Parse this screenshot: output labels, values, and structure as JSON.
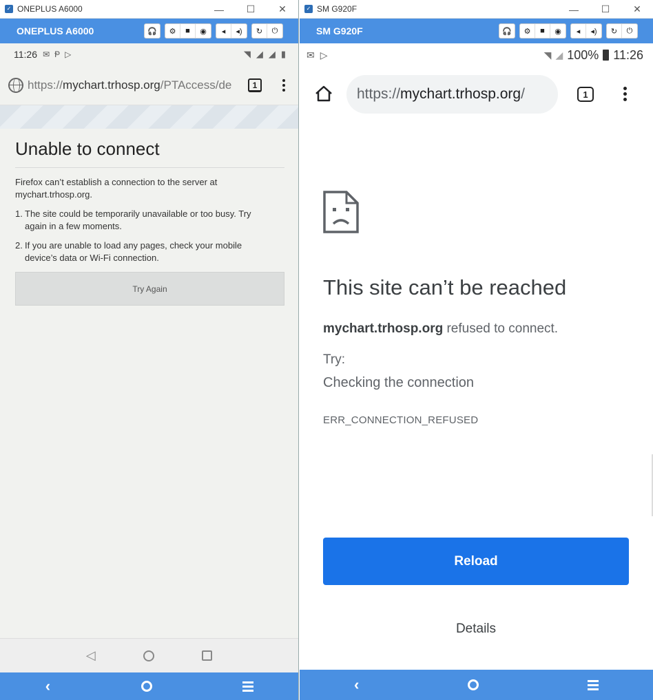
{
  "left_window": {
    "title": "ONEPLUS A6000",
    "controls": {
      "minimize": "—",
      "maximize": "☐",
      "close": "✕"
    },
    "device_name": "ONEPLUS A6000",
    "status": {
      "time": "11:26"
    },
    "url": {
      "prefix": "https://",
      "host": "mychart.trhosp.org",
      "path": "/PTAccess/de"
    },
    "tab_count": "1",
    "error": {
      "title": "Unable to connect",
      "description": "Firefox can’t establish a connection to the server at mychart.trhosp.org.",
      "items": [
        {
          "num": "1.",
          "text": "The site could be temporarily unavailable or too busy. Try again in a few moments."
        },
        {
          "num": "2.",
          "text": "If you are unable to load any pages, check your mobile device’s data or Wi-Fi connection."
        }
      ],
      "button": "Try Again"
    }
  },
  "right_window": {
    "title": "SM G920F",
    "controls": {
      "minimize": "—",
      "maximize": "☐",
      "close": "✕"
    },
    "device_name": "SM G920F",
    "status": {
      "battery": "100%",
      "time": "11:26"
    },
    "url": {
      "prefix": "https://",
      "host": "mychart.trhosp.org",
      "path": "/"
    },
    "tab_count": "1",
    "error": {
      "title": "This site can’t be reached",
      "host": "mychart.trhosp.org",
      "message_suffix": " refused to connect.",
      "try_label": "Try:",
      "suggestion": "Checking the connection",
      "code": "ERR_CONNECTION_REFUSED",
      "reload_button": "Reload",
      "details_button": "Details"
    }
  },
  "toolbar_icons": [
    "headset-icon",
    "gear-icon",
    "camera-icon",
    "screenshot-icon",
    "volume-down-icon",
    "volume-up-icon",
    "rotate-icon",
    "power-icon"
  ],
  "colors": {
    "host_bar": "#4a90e2",
    "reload_button": "#1a73e8"
  }
}
